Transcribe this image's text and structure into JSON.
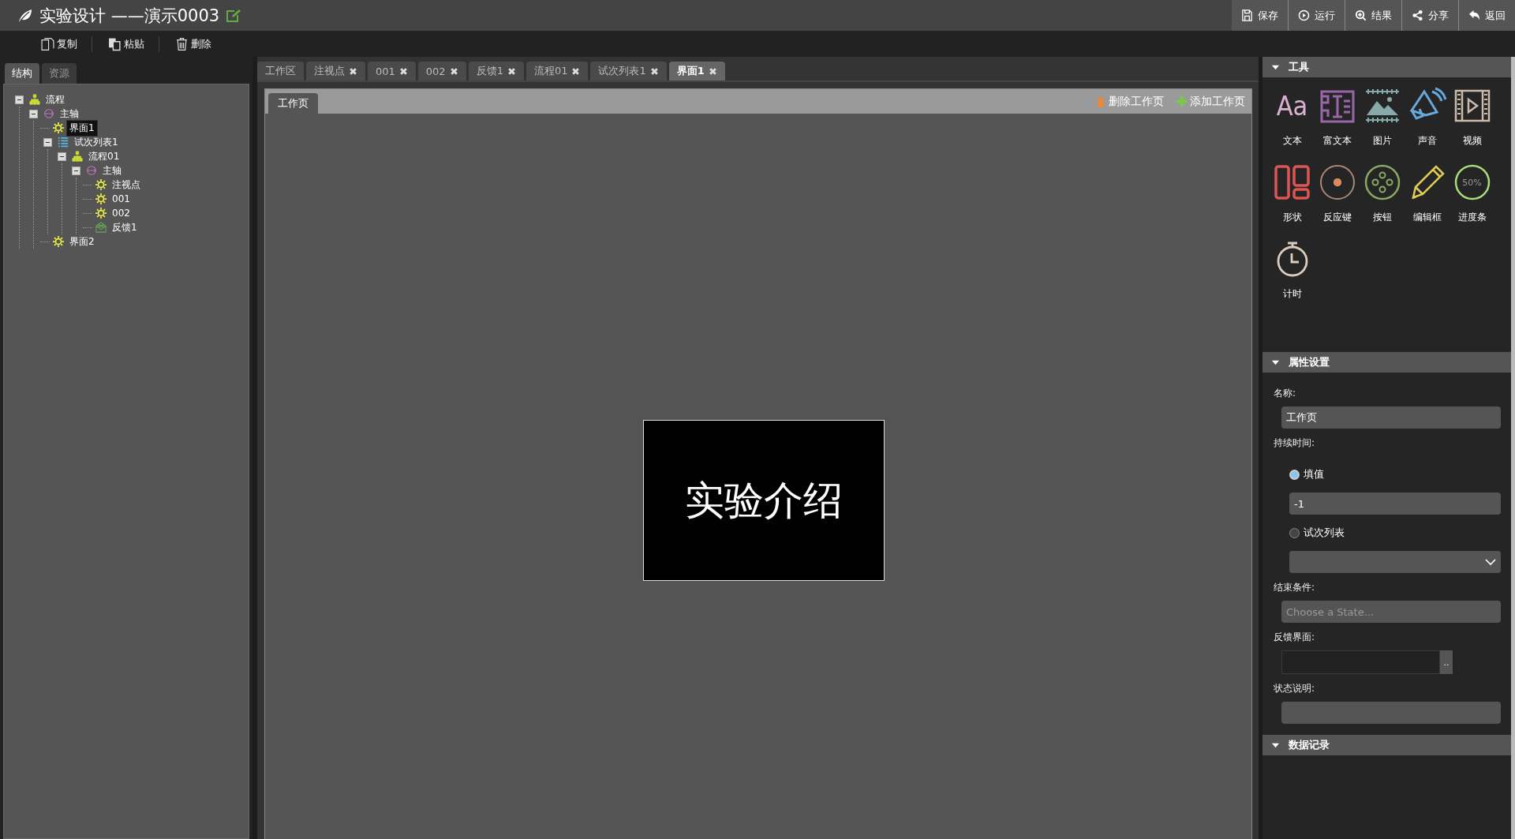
{
  "window": {
    "title": "实验设计 ——演示0003"
  },
  "header_actions": [
    {
      "kind": "save",
      "label": "保存"
    },
    {
      "kind": "run",
      "label": "运行"
    },
    {
      "kind": "results",
      "label": "结果"
    },
    {
      "kind": "share",
      "label": "分享"
    },
    {
      "kind": "back",
      "label": "返回"
    }
  ],
  "edit_toolbar": [
    {
      "kind": "copy",
      "label": "复制"
    },
    {
      "kind": "paste",
      "label": "粘贴"
    },
    {
      "kind": "delete",
      "label": "删除"
    }
  ],
  "left_panel": {
    "tabs": [
      {
        "label": "结构",
        "selected": true
      },
      {
        "label": "资源",
        "selected": false
      }
    ],
    "tree": [
      {
        "kind": "flow",
        "label": "流程",
        "selected": false,
        "expanded": true,
        "children": [
          {
            "kind": "axis",
            "label": "主轴",
            "selected": false,
            "expanded": true,
            "children": [
              {
                "kind": "screen",
                "label": "界面1",
                "selected": true
              },
              {
                "kind": "list",
                "label": "试次列表1",
                "selected": false,
                "expanded": true,
                "children": [
                  {
                    "kind": "flow",
                    "label": "流程01",
                    "selected": false,
                    "expanded": true,
                    "children": [
                      {
                        "kind": "axis",
                        "label": "主轴",
                        "selected": false,
                        "expanded": true,
                        "children": [
                          {
                            "kind": "screen",
                            "label": "注视点",
                            "selected": false
                          },
                          {
                            "kind": "screen",
                            "label": "001",
                            "selected": false
                          },
                          {
                            "kind": "screen",
                            "label": "002",
                            "selected": false
                          },
                          {
                            "kind": "feedback",
                            "label": "反馈1",
                            "selected": false
                          }
                        ]
                      }
                    ]
                  }
                ]
              },
              {
                "kind": "screen",
                "label": "界面2",
                "selected": false
              }
            ]
          }
        ]
      }
    ]
  },
  "editor": {
    "tabs": [
      {
        "label": "工作区",
        "closable": false,
        "selected": false
      },
      {
        "label": "注视点",
        "closable": true,
        "selected": false
      },
      {
        "label": "001",
        "closable": true,
        "selected": false
      },
      {
        "label": "002",
        "closable": true,
        "selected": false
      },
      {
        "label": "反馈1",
        "closable": true,
        "selected": false
      },
      {
        "label": "流程01",
        "closable": true,
        "selected": false
      },
      {
        "label": "试次列表1",
        "closable": true,
        "selected": false
      },
      {
        "label": "界面1",
        "closable": true,
        "selected": true
      }
    ],
    "page_tabs": [
      {
        "label": "工作页",
        "selected": true
      }
    ],
    "page_actions": [
      {
        "kind": "delete",
        "label": "删除工作页"
      },
      {
        "kind": "add",
        "label": "添加工作页"
      }
    ],
    "canvas": {
      "stimulus_text": "实验介绍"
    }
  },
  "right_panel": {
    "tools_section": {
      "title": "工具",
      "expanded": true,
      "tools": [
        {
          "kind": "text",
          "label": "文本",
          "icon_text": "Aa"
        },
        {
          "kind": "rich_text",
          "label": "富文本"
        },
        {
          "kind": "image",
          "label": "图片"
        },
        {
          "kind": "sound",
          "label": "声音"
        },
        {
          "kind": "video",
          "label": "视频"
        },
        {
          "kind": "shape",
          "label": "形状"
        },
        {
          "kind": "response_key",
          "label": "反应键"
        },
        {
          "kind": "button",
          "label": "按钮"
        },
        {
          "kind": "edit_box",
          "label": "编辑框"
        },
        {
          "kind": "progress",
          "label": "进度条",
          "icon_text": "50%"
        },
        {
          "kind": "timer",
          "label": "计时"
        }
      ]
    },
    "properties_section": {
      "title": "属性设置",
      "expanded": true,
      "name": {
        "label": "名称:",
        "value": "工作页"
      },
      "duration": {
        "label": "持续时间:",
        "options": [
          {
            "label": "填值",
            "selected": true
          },
          {
            "label": "试次列表",
            "selected": false
          }
        ],
        "value": "-1"
      },
      "end_condition": {
        "label": "结束条件:",
        "placeholder": "Choose a State..."
      },
      "feedback_screen": {
        "label": "反馈界面:",
        "button": ".."
      },
      "state_note": {
        "label": "状态说明:"
      }
    },
    "data_record_section": {
      "title": "数据记录",
      "expanded": true
    }
  }
}
